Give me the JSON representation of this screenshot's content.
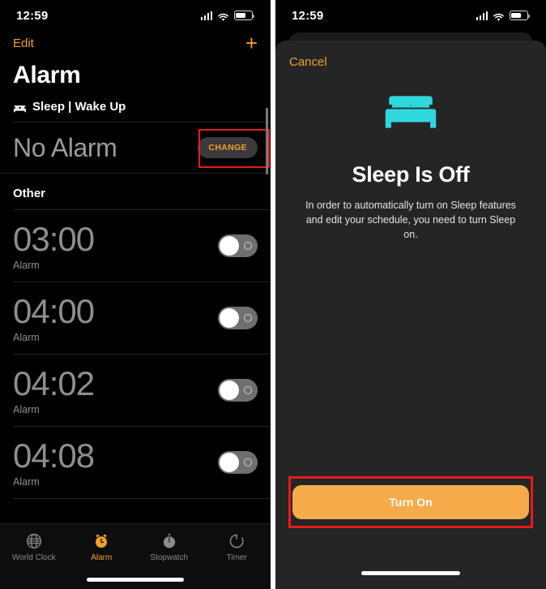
{
  "left": {
    "status": {
      "time": "12:59",
      "signal_icon": "cellular-signal-icon",
      "wifi_icon": "wifi-icon",
      "battery_icon": "battery-icon"
    },
    "nav": {
      "edit_label": "Edit",
      "add_icon": "plus-icon"
    },
    "title": "Alarm",
    "sleep_section": {
      "bed_icon": "bed-icon",
      "header": "Sleep | Wake Up",
      "value": "No Alarm",
      "change_label": "CHANGE"
    },
    "other_section": {
      "header": "Other",
      "alarms": [
        {
          "time": "03:00",
          "label": "Alarm",
          "enabled": false
        },
        {
          "time": "04:00",
          "label": "Alarm",
          "enabled": false
        },
        {
          "time": "04:02",
          "label": "Alarm",
          "enabled": false
        },
        {
          "time": "04:08",
          "label": "Alarm",
          "enabled": false
        }
      ]
    },
    "tabbar": [
      {
        "label": "World Clock",
        "icon": "globe-icon",
        "active": false
      },
      {
        "label": "Alarm",
        "icon": "alarm-clock-icon",
        "active": true
      },
      {
        "label": "Stopwatch",
        "icon": "stopwatch-icon",
        "active": false
      },
      {
        "label": "Timer",
        "icon": "timer-icon",
        "active": false
      }
    ]
  },
  "right": {
    "status": {
      "time": "12:59",
      "signal_icon": "cellular-signal-icon",
      "wifi_icon": "wifi-icon",
      "battery_icon": "battery-icon"
    },
    "sheet": {
      "cancel_label": "Cancel",
      "bed_icon": "bed-icon",
      "title": "Sleep Is Off",
      "description": "In order to automatically turn on Sleep features and edit your schedule, you need to turn Sleep on.",
      "turn_on_label": "Turn On"
    }
  },
  "colors": {
    "accent_orange": "#f0a029",
    "button_orange": "#f5ab4a",
    "bed_cyan": "#2fd8dd",
    "annotation_red": "#e81b1b",
    "sheet_bg": "#252525"
  }
}
